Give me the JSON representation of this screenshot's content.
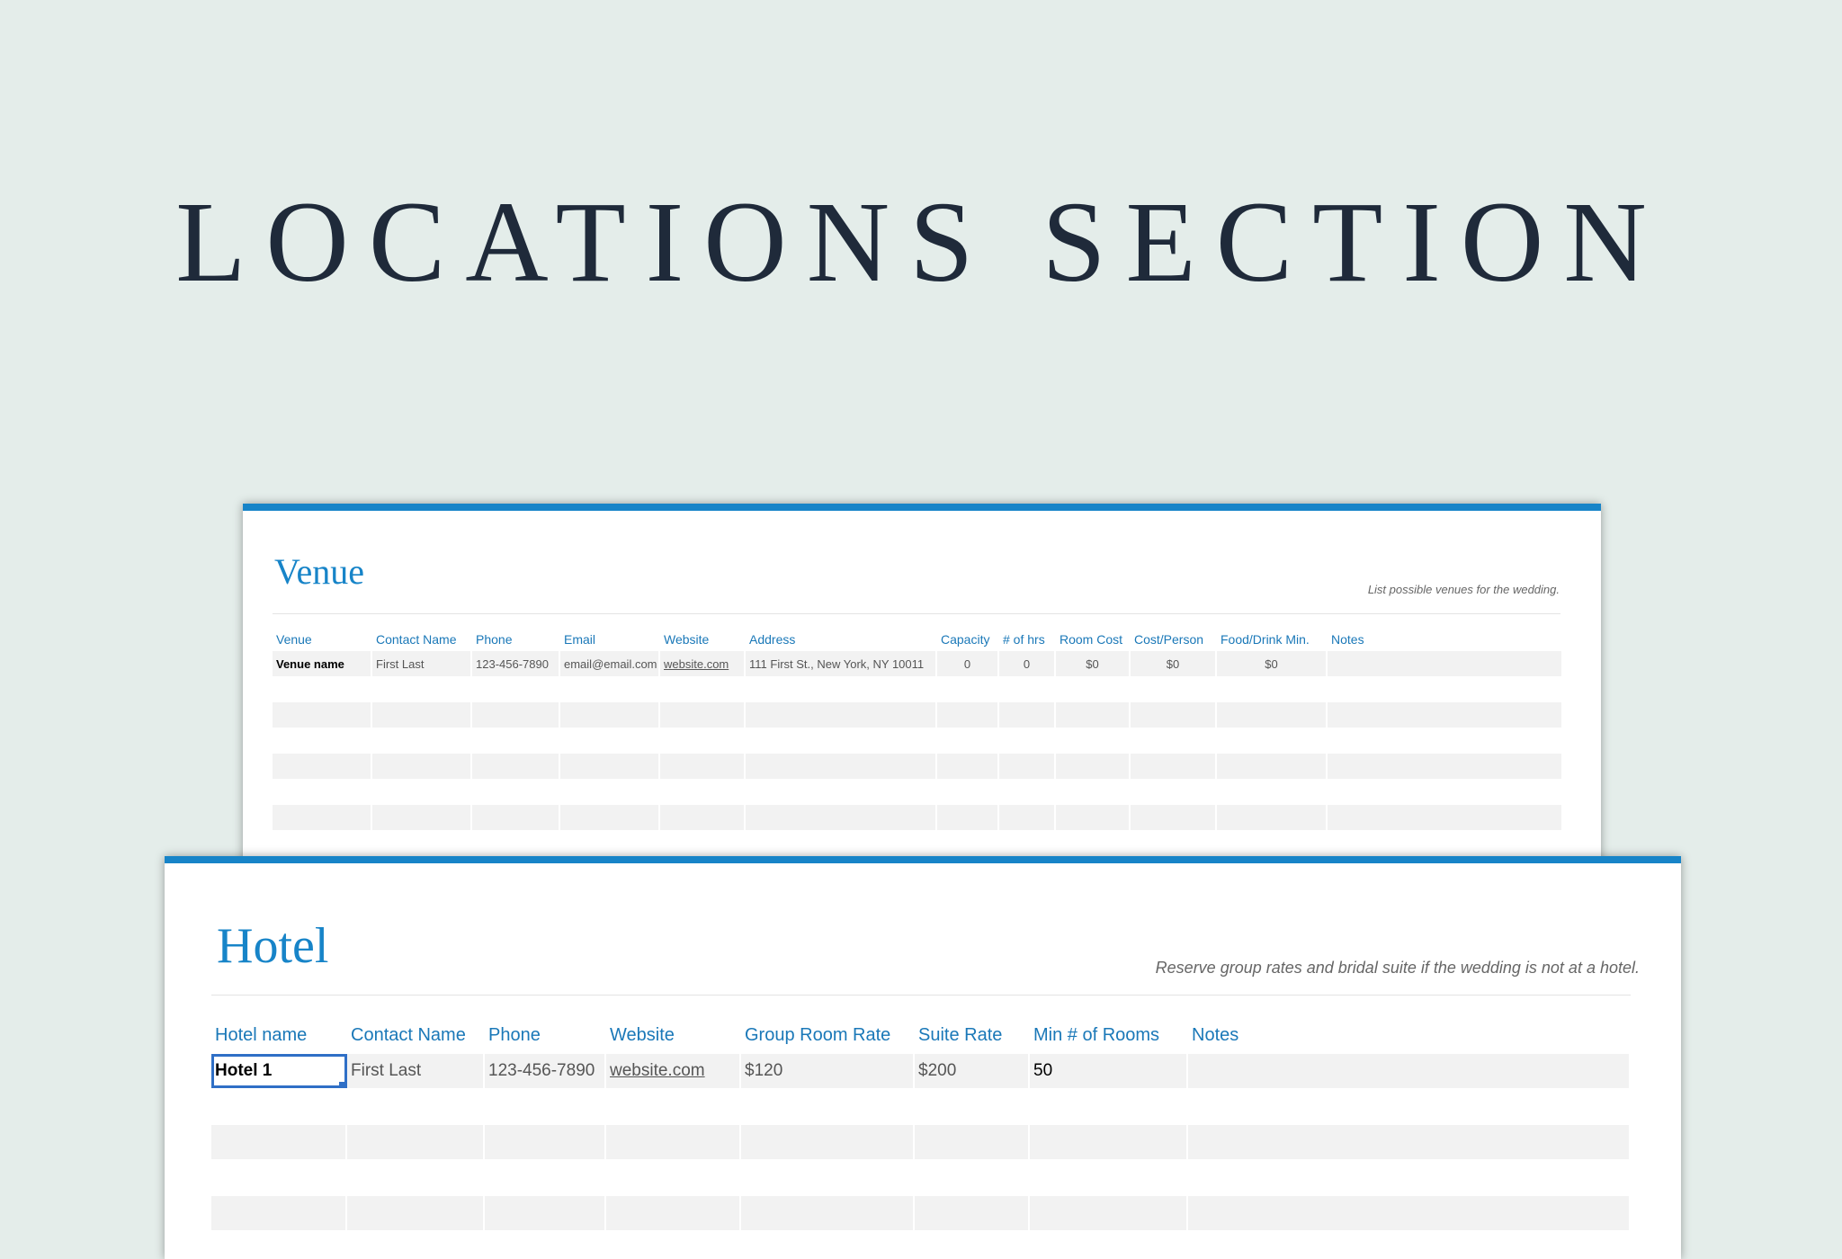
{
  "page_title": "LOCATIONS SECTION",
  "accent_color": "#1784c8",
  "venue": {
    "title": "Venue",
    "note": "List possible venues for the wedding.",
    "headers": [
      "Venue",
      "Contact Name",
      "Phone",
      "Email",
      "Website",
      "Address",
      "Capacity",
      "# of hrs",
      "Room Cost",
      "Cost/Person",
      "Food/Drink Min.",
      "Notes"
    ],
    "rows": [
      [
        "Venue name",
        "First Last",
        "123-456-7890",
        "email@email.com",
        "website.com",
        "111 First St., New York, NY 10011",
        "0",
        "0",
        "$0",
        "$0",
        "$0",
        ""
      ],
      [
        "",
        "",
        "",
        "",
        "",
        "",
        "",
        "",
        "",
        "",
        "",
        ""
      ],
      [
        "",
        "",
        "",
        "",
        "",
        "",
        "",
        "",
        "",
        "",
        "",
        ""
      ],
      [
        "",
        "",
        "",
        "",
        "",
        "",
        "",
        "",
        "",
        "",
        "",
        ""
      ]
    ]
  },
  "hotel": {
    "title": "Hotel",
    "note": "Reserve group rates and bridal suite if the wedding is not at a hotel.",
    "headers": [
      "Hotel name",
      "Contact Name",
      "Phone",
      "Website",
      "Group Room Rate",
      "Suite Rate",
      "Min # of Rooms",
      "Notes"
    ],
    "rows": [
      [
        "Hotel 1",
        "First Last",
        "123-456-7890",
        "website.com",
        "$120",
        "$200",
        "50",
        ""
      ],
      [
        "",
        "",
        "",
        "",
        "",
        "",
        "",
        ""
      ],
      [
        "",
        "",
        "",
        "",
        "",
        "",
        "",
        ""
      ]
    ]
  }
}
